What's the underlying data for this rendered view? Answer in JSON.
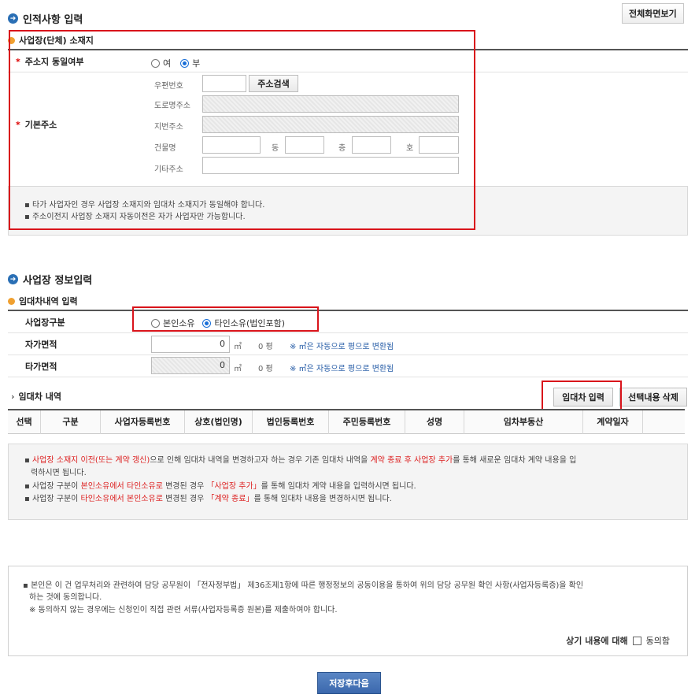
{
  "header": {
    "title": "인적사항 입력",
    "fullscreen_label": "전체화면보기"
  },
  "location": {
    "subtitle": "사업장(단체) 소재지",
    "same_address_label": "주소지 동일여부",
    "same_address_options": [
      "여",
      "부"
    ],
    "base_address_label": "기본주소",
    "postal_label": "우편번호",
    "address_search_label": "주소검색",
    "road_label": "도로명주소",
    "lot_label": "지번주소",
    "building_label": "건물명",
    "dong_label": "동",
    "floor_label": "층",
    "ho_label": "호",
    "etc_label": "기타주소",
    "notices": [
      "타가 사업자인 경우 사업장 소재지와 임대차 소재지가 동일해야 합니다.",
      "주소이전지 사업장 소재지 자동이전은 자가 사업자만 가능합니다."
    ]
  },
  "business": {
    "title": "사업장 정보입력",
    "lease_subtitle": "임대차내역 입력",
    "type_label": "사업장구분",
    "type_options": [
      "본인소유",
      "타인소유(법인포함)"
    ],
    "own_area_label": "자가면적",
    "own_area_value": "0",
    "other_area_label": "타가면적",
    "other_area_value": "0",
    "unit_m2": "㎡",
    "pyeong_value": "0 평",
    "convert_note": "※ ㎡은 자동으로 평으로 변환됨"
  },
  "lease": {
    "title": "임대차 내역",
    "input_button": "임대차 입력",
    "delete_button": "선택내용 삭제",
    "columns": [
      "선택",
      "구분",
      "사업자등록번호",
      "상호(법인명)",
      "법인등록번호",
      "주민등록번호",
      "성명",
      "임차부동산",
      "계약일자"
    ],
    "notice1_red": "사업장 소재지 이전(또는 계약 갱신)",
    "notice1_a": "으로 인해 임대차 내역을 변경하고자 하는 경우 기존 임대차 내역을 ",
    "notice1_red2": "계약 종료 후 사업장 추가",
    "notice1_b": "를 통해 새로운 임대차 계약 내용을 입",
    "notice1_c": "력하시면 됩니다.",
    "notice2_a": "사업장 구분이 ",
    "notice2_red": "본인소유에서 타인소유로",
    "notice2_b": " 변경된 경우 ",
    "notice2_red2": "「사업장 추가」",
    "notice2_c": "를 통해 임대차 계약 내용을 입력하시면 됩니다.",
    "notice3_a": "사업장 구분이 ",
    "notice3_red": "타인소유에서 본인소유로",
    "notice3_b": " 변경된 경우 ",
    "notice3_red2": "「계약 종료」",
    "notice3_c": "를 통해 임대차 내용을 변경하시면 됩니다."
  },
  "consent": {
    "line1": "본인은 이 건 업무처리와 관련하여 담당 공무원이 「전자정부법」 제36조제1항에 따른 행정정보의 공동이용을 통하여 위의 담당 공무원 확인 사항(사업자등록증)을 확인",
    "line2": "하는 것에 동의합니다.",
    "line3": "※ 동의하지 않는 경우에는 신청인이 직접 관련 서류(사업자등록증 원본)를 제출하여야 합니다.",
    "agree_prefix": "상기 내용에 대해",
    "agree_label": "동의함"
  },
  "footer": {
    "save_label": "저장후다음"
  }
}
